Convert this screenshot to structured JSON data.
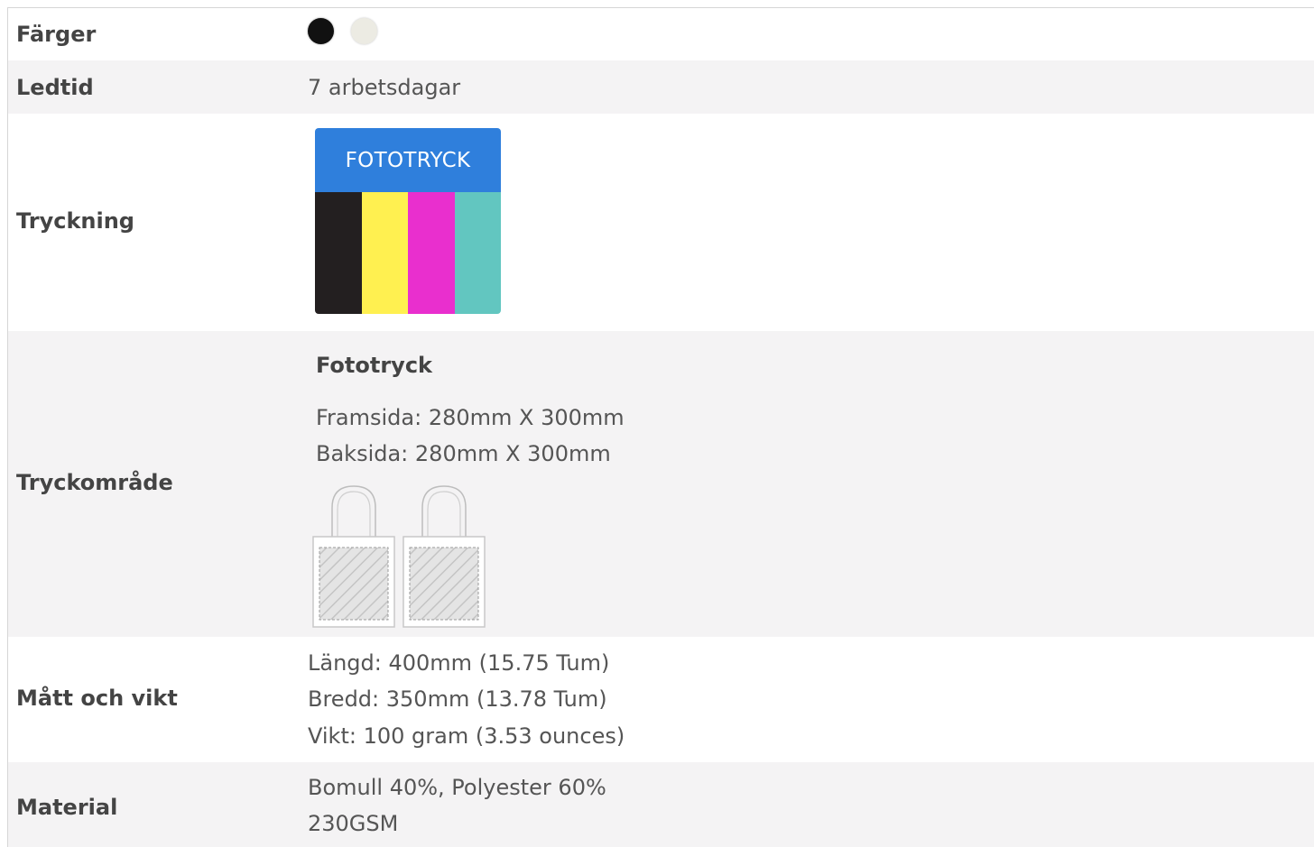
{
  "rows": {
    "colors": {
      "label": "Färger",
      "swatches": [
        {
          "name": "black",
          "color": "#111111"
        },
        {
          "name": "natural",
          "color": "#ecebe3"
        }
      ]
    },
    "lead_time": {
      "label": "Ledtid",
      "value": "7 arbetsdagar"
    },
    "printing": {
      "label": "Tryckning",
      "option_title": "FOTOTRYCK",
      "header_color": "#2f7fdc",
      "bar_colors": [
        "#231f20",
        "#fff050",
        "#e92fce",
        "#62c6c0"
      ]
    },
    "print_area": {
      "label": "Tryckområde",
      "method": "Fototryck",
      "front": "Framsida: 280mm X 300mm",
      "back": "Baksida: 280mm X 300mm",
      "images": [
        "tote-bag-front-icon",
        "tote-bag-back-icon"
      ]
    },
    "dimensions": {
      "label": "Mått och vikt",
      "length": "Längd: 400mm (15.75 Tum)",
      "width": "Bredd: 350mm (13.78 Tum)",
      "weight": "Vikt: 100 gram (3.53 ounces)"
    },
    "material": {
      "label": "Material",
      "composition": "Bomull 40%, Polyester 60%",
      "weight": "230GSM"
    }
  }
}
